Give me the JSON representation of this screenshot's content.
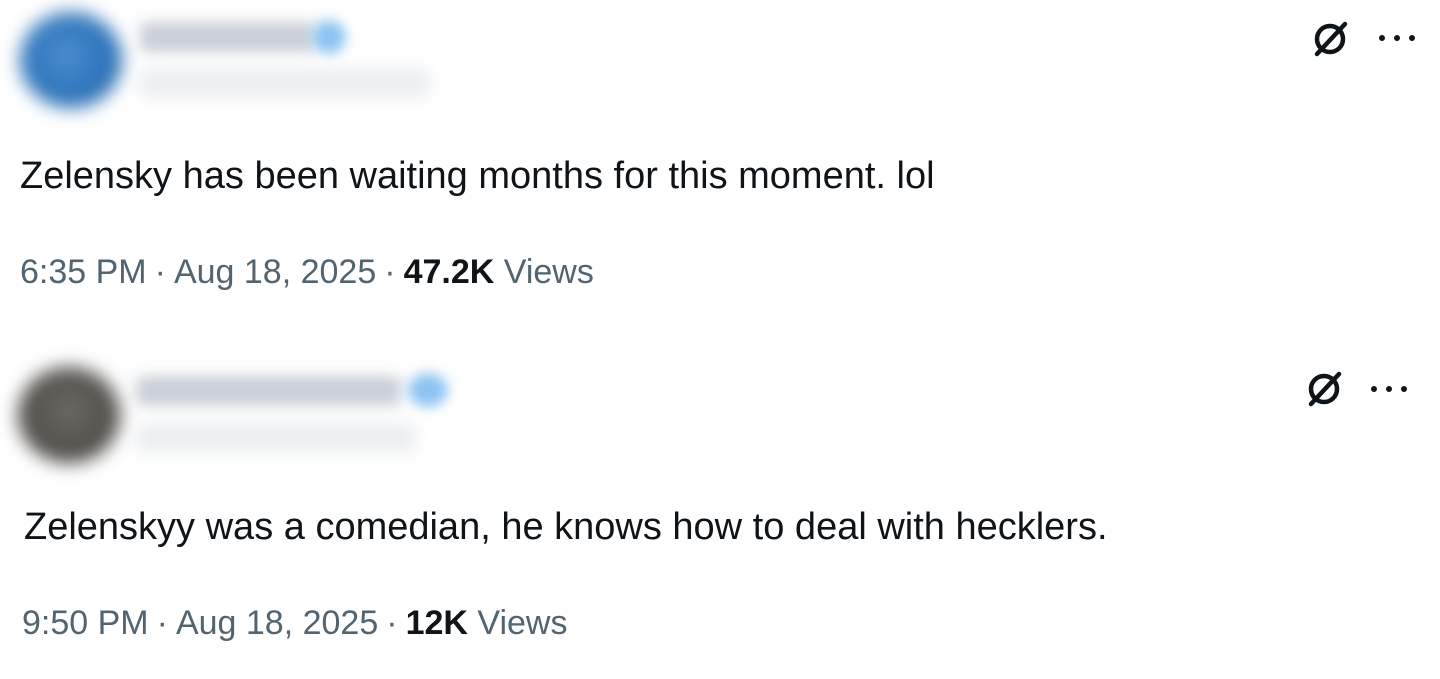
{
  "tweets": [
    {
      "text": "Zelensky has been waiting months for this moment. lol",
      "time": "6:35 PM",
      "date": "Aug 18, 2025",
      "views_count": "47.2K",
      "views_label": "Views",
      "separator": "·",
      "icons": {
        "grok": "grok-icon",
        "more": "more-icon"
      }
    },
    {
      "text": "Zelenskyy was a comedian, he knows how to deal with hecklers.",
      "time": "9:50 PM",
      "date": "Aug 18, 2025",
      "views_count": "12K",
      "views_label": "Views",
      "separator": "·",
      "icons": {
        "grok": "grok-icon",
        "more": "more-icon"
      }
    }
  ],
  "colors": {
    "text_primary": "#0f1419",
    "text_secondary": "#536471",
    "background": "#ffffff"
  }
}
